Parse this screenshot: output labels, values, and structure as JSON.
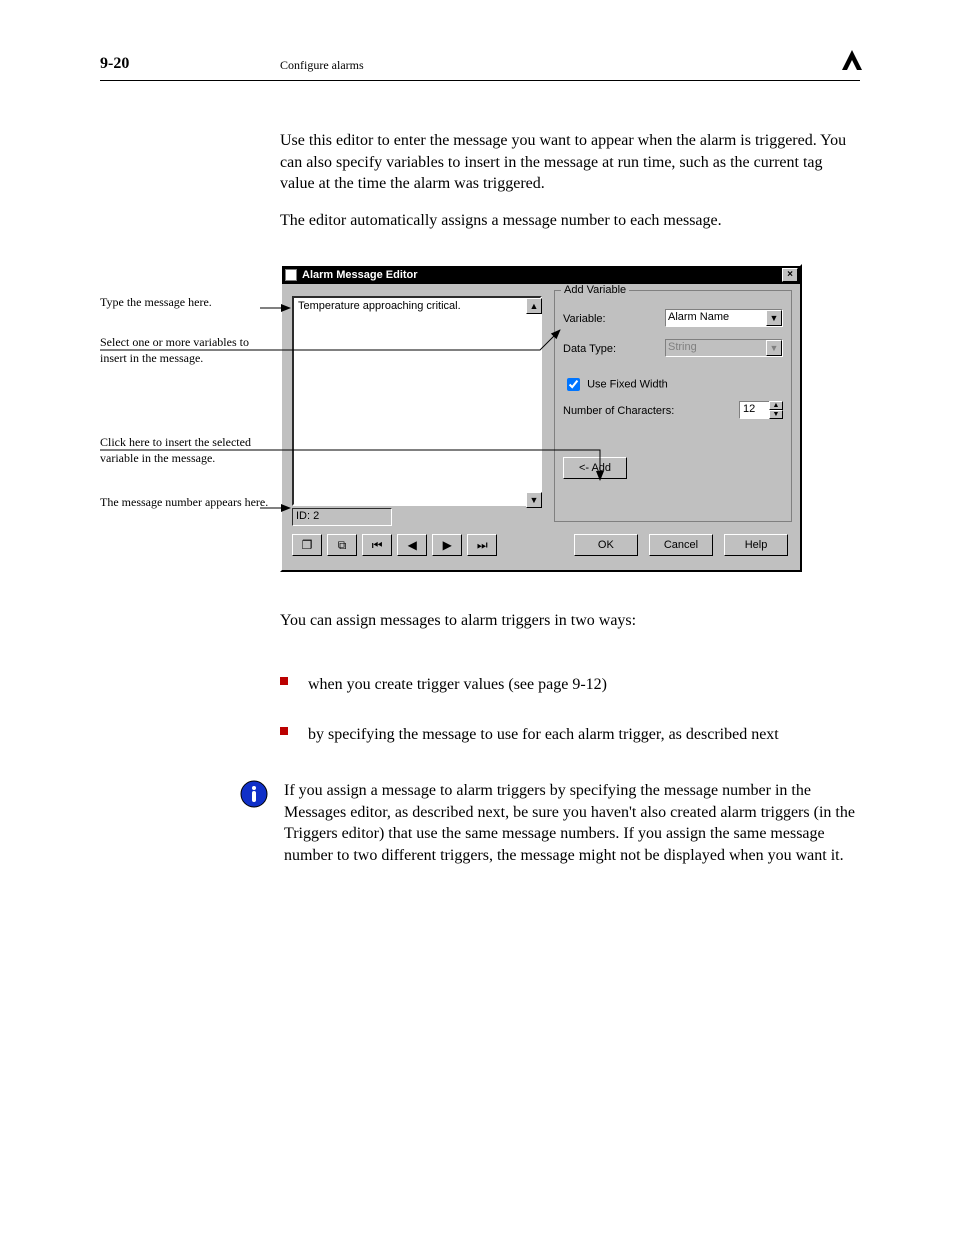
{
  "page": {
    "number": "9-20",
    "chapter_title": "Configure alarms"
  },
  "intro": {
    "p1": "Use this editor to enter the message you want to appear when the alarm is triggered. You can also specify variables to insert in the message at run time, such as the current tag value at the time the alarm was triggered.",
    "p2": "The editor automatically assigns a message number to each message."
  },
  "captions": {
    "c1": "Type the message here.",
    "c2": "Select one or more variables to insert in the message.",
    "c3": "Click here to insert the selected variable in the message.",
    "c4": "The message number appears here."
  },
  "dialog": {
    "title": "Alarm Message Editor",
    "close_glyph": "×",
    "message_text": "Temperature approaching critical.",
    "id_text": "ID: 2",
    "group": {
      "legend": "Add Variable",
      "variable_label": "Variable:",
      "variable_value": "Alarm Name",
      "datatype_label": "Data Type:",
      "datatype_value": "String",
      "fixedwidth_label": "Use Fixed Width",
      "fixedwidth_checked": true,
      "noc_label": "Number of Characters:",
      "noc_value": "12",
      "add_label": "<- Add"
    },
    "toolbar": {
      "new_glyph": "❐",
      "copy_glyph": "⧉",
      "first_glyph": "⏮",
      "prev_glyph": "◀",
      "next_glyph": "▶",
      "last_glyph": "⏭"
    },
    "btn_ok": "OK",
    "btn_cancel": "Cancel",
    "btn_help": "Help"
  },
  "after": {
    "p1": "You can assign messages to alarm triggers in two ways:",
    "b1": "when you create trigger values (see page 9-12)",
    "b2": "by specifying the message to use for each alarm trigger, as described next",
    "note": "If you assign a message to alarm triggers by specifying the message number in the Messages editor, as described next, be sure you haven't also created alarm triggers (in the Triggers editor) that use the same message numbers. If you assign the same message number to two different triggers, the message might not be displayed when you want it."
  }
}
